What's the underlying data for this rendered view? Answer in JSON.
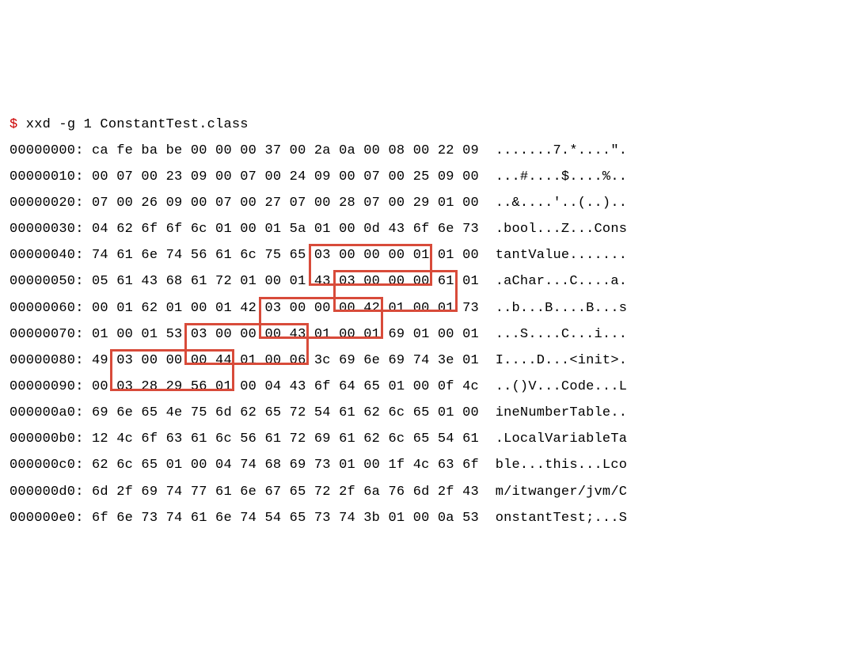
{
  "command": {
    "prompt": "$",
    "text": " xxd -g 1 ConstantTest.class"
  },
  "rows": [
    {
      "offset": "00000000:",
      "hex": " ca fe ba be 00 00 00 37 00 2a 0a 00 08 00 22 09",
      "ascii": "  .......7.*....\"."
    },
    {
      "offset": "00000010:",
      "hex": " 00 07 00 23 09 00 07 00 24 09 00 07 00 25 09 00",
      "ascii": "  ...#....$....%.."
    },
    {
      "offset": "00000020:",
      "hex": " 07 00 26 09 00 07 00 27 07 00 28 07 00 29 01 00",
      "ascii": "  ..&....'..(..).."
    },
    {
      "offset": "00000030:",
      "hex": " 04 62 6f 6f 6c 01 00 01 5a 01 00 0d 43 6f 6e 73",
      "ascii": "  .bool...Z...Cons"
    },
    {
      "offset": "00000040:",
      "hex": " 74 61 6e 74 56 61 6c 75 65 03 00 00 00 01 01 00",
      "ascii": "  tantValue......."
    },
    {
      "offset": "00000050:",
      "hex": " 05 61 43 68 61 72 01 00 01 43 03 00 00 00 61 01",
      "ascii": "  .aChar...C....a."
    },
    {
      "offset": "00000060:",
      "hex": " 00 01 62 01 00 01 42 03 00 00 00 42 01 00 01 73",
      "ascii": "  ..b...B....B...s"
    },
    {
      "offset": "00000070:",
      "hex": " 01 00 01 53 03 00 00 00 43 01 00 01 69 01 00 01",
      "ascii": "  ...S....C...i..."
    },
    {
      "offset": "00000080:",
      "hex": " 49 03 00 00 00 44 01 00 06 3c 69 6e 69 74 3e 01",
      "ascii": "  I....D...<init>."
    },
    {
      "offset": "00000090:",
      "hex": " 00 03 28 29 56 01 00 04 43 6f 64 65 01 00 0f 4c",
      "ascii": "  ..()V...Code...L"
    },
    {
      "offset": "000000a0:",
      "hex": " 69 6e 65 4e 75 6d 62 65 72 54 61 62 6c 65 01 00",
      "ascii": "  ineNumberTable.."
    },
    {
      "offset": "000000b0:",
      "hex": " 12 4c 6f 63 61 6c 56 61 72 69 61 62 6c 65 54 61",
      "ascii": "  .LocalVariableTa"
    },
    {
      "offset": "000000c0:",
      "hex": " 62 6c 65 01 00 04 74 68 69 73 01 00 1f 4c 63 6f",
      "ascii": "  ble...this...Lco"
    },
    {
      "offset": "000000d0:",
      "hex": " 6d 2f 69 74 77 61 6e 67 65 72 2f 6a 76 6d 2f 43",
      "ascii": "  m/itwanger/jvm/C"
    },
    {
      "offset": "000000e0:",
      "hex": " 6f 6e 73 74 61 6e 74 54 65 73 74 3b 01 00 0a 53",
      "ascii": "  onstantTest;...S"
    }
  ],
  "highlights": [
    {
      "row": 4,
      "start": 9,
      "end": 14
    },
    {
      "row": 5,
      "start": 10,
      "end": 15
    },
    {
      "row": 6,
      "start": 7,
      "end": 12
    },
    {
      "row": 7,
      "start": 4,
      "end": 9
    },
    {
      "row": 8,
      "start": 1,
      "end": 6
    }
  ]
}
